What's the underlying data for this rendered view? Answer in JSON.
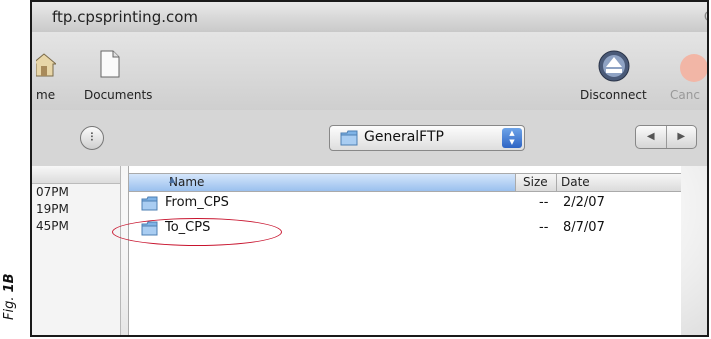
{
  "window": {
    "title": "ftp.cpsprinting.com"
  },
  "toolbar": {
    "home_label": "me",
    "documents_label": "Documents",
    "disconnect_label": "Disconnect",
    "cancel_label": "Canc"
  },
  "pathbar": {
    "current_folder": "GeneralFTP"
  },
  "left_column": {
    "rows": [
      "07PM",
      "19PM",
      "45PM"
    ]
  },
  "file_list": {
    "columns": {
      "name": "Name",
      "size": "Size",
      "date": "Date"
    },
    "rows": [
      {
        "name": "From_CPS",
        "size": "--",
        "date": "2/2/07"
      },
      {
        "name": "To_CPS",
        "size": "--",
        "date": "8/7/07"
      }
    ]
  },
  "figure": {
    "prefix": "Fig.",
    "number": "1B"
  },
  "colors": {
    "highlight": "#c8142e",
    "header_selected": "#9ac0ee",
    "folder": "#7fb3e6"
  }
}
